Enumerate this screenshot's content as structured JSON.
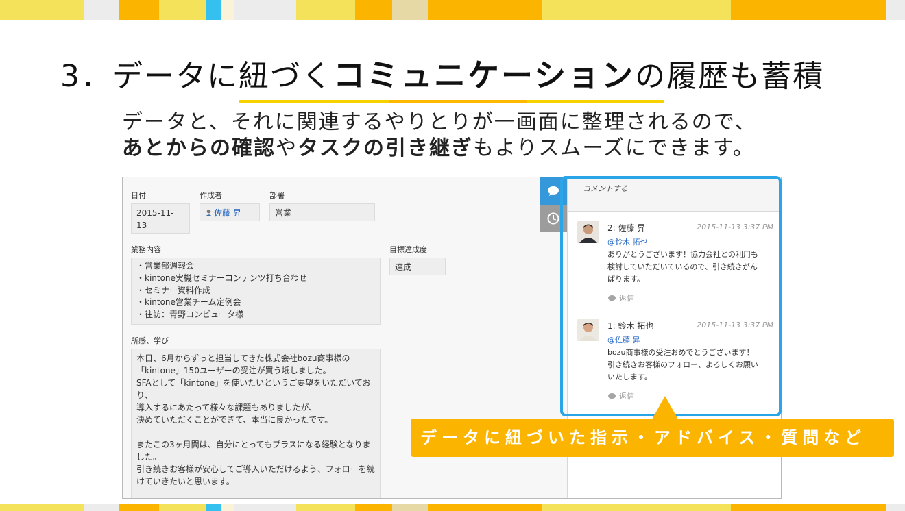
{
  "colors": {
    "accent_yellow": "#fbb400",
    "frame_blue": "#29a5e8",
    "link_blue": "#2466c2"
  },
  "slide": {
    "title_num": "3．",
    "title_pre": "データに紐づく",
    "title_bold": "コミュニケーション",
    "title_post": "の履歴も蓄積",
    "subtitle_line1": "データと、それに関連するやりとりが一画面に整理されるので、",
    "subtitle_line2_b1": "あとからの確認",
    "subtitle_line2_t1": "や",
    "subtitle_line2_b2": "タスクの引き継ぎ",
    "subtitle_line2_t2": "もよりスムーズにできます。"
  },
  "record": {
    "date_label": "日付",
    "date_value": "2015-11-\n13",
    "creator_label": "作成者",
    "creator_value": "佐藤 昇",
    "dept_label": "部署",
    "dept_value": "営業",
    "tasks_label": "業務内容",
    "tasks_value": "・営業部週報会\n・kintone実機セミナーコンテンツ打ち合わせ\n・セミナー資料作成\n・kintone営業チーム定例会\n・往訪：青野コンピュータ様",
    "goal_label": "目標達成度",
    "goal_value": "達成",
    "learn_label": "所感、学び",
    "learn_value": "本日、6月からずっと担当してきた株式会社bozu商事様の\n「kintone」150ユーザーの受注が買う坻しました。\nSFAとして「kintone」を使いたいというご要望をいただいてお\nり、\n導入するにあたって様々な課題もありましたが、\n決めていただくことができて、本当に良かったです。\n\nまたこの3ヶ月間は、自分にとってもプラスになる経験となりま\nした。\n引き続きお客様が安心してご導入いただけるよう、フォローを続\nけていきたいと思います。"
  },
  "sidebar": {
    "comment_icon": "speech-bubble-icon",
    "history_icon": "clock-icon"
  },
  "comments": {
    "input_placeholder": "コメントする",
    "items": [
      {
        "author": "2: 佐藤 昇",
        "time": "2015-11-13 3:37 PM",
        "mention": "@鈴木 拓也",
        "body": "ありがとうございます！協力会社との利用も\n検討していただいているので、引き続きがん\nばります。",
        "reply": "返信"
      },
      {
        "author": "1: 鈴木 拓也",
        "time": "2015-11-13 3:37 PM",
        "mention": "@佐藤 昇",
        "body": "bozu商事様の受注おめでとうございます！\n引き続きお客様のフォロー、よろしくお願い\nいたします。",
        "reply": "返信"
      }
    ]
  },
  "callout": {
    "text": "データに紐づいた指示・アドバイス・質問など"
  }
}
